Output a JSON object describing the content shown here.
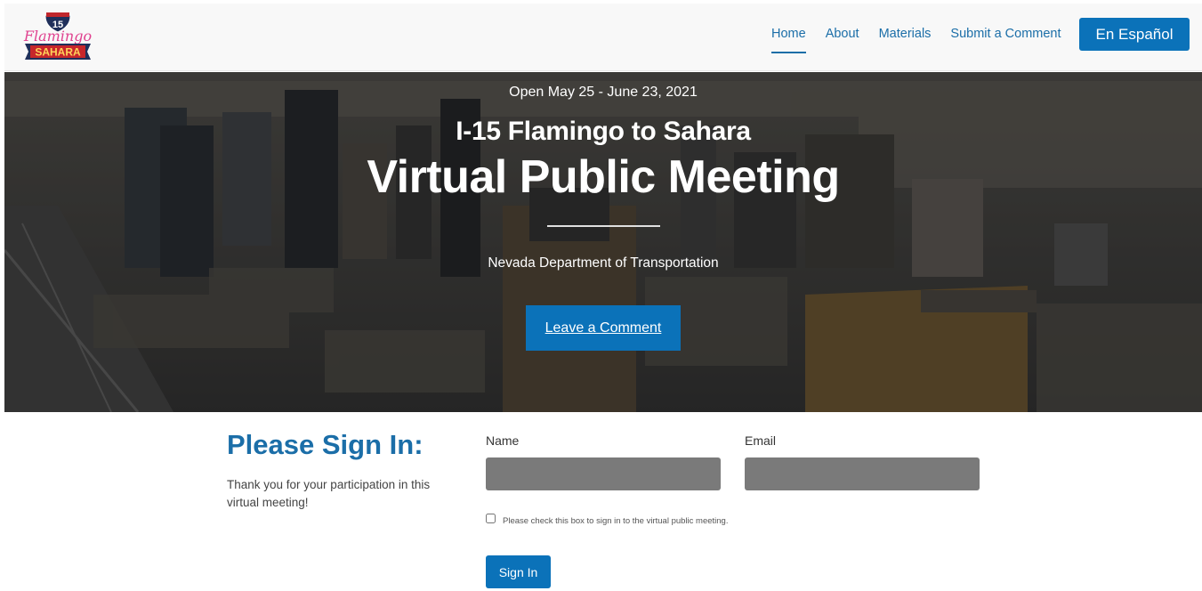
{
  "header": {
    "logo": {
      "shield_number": "15",
      "script_text": "Flamingo",
      "banner_text": "SAHARA",
      "icon": "i15-flamingo-sahara-logo"
    },
    "nav": [
      {
        "label": "Home",
        "active": true
      },
      {
        "label": "About",
        "active": false
      },
      {
        "label": "Materials",
        "active": false
      },
      {
        "label": "Submit a Comment",
        "active": false
      }
    ],
    "language_button": "En Español"
  },
  "hero": {
    "open_dates": "Open May 25 - June 23, 2021",
    "subtitle": "I-15 Flamingo to Sahara",
    "title": "Virtual Public Meeting",
    "agency": "Nevada Department of Transportation",
    "cta_label": "Leave a Comment",
    "background": "aerial-city-skyline-image"
  },
  "signin": {
    "title": "Please Sign In:",
    "description": "Thank you for your participation in this virtual meeting!",
    "name_label": "Name",
    "email_label": "Email",
    "name_value": "",
    "email_value": "",
    "checkbox_label": "Please check this box to sign in to the virtual public meeting.",
    "checkbox_checked": false,
    "submit_label": "Sign In"
  },
  "colors": {
    "primary": "#0b72b9",
    "link": "#1b6ea8",
    "input_bg": "#7a7a7a",
    "header_bg": "#f8f8f8"
  }
}
